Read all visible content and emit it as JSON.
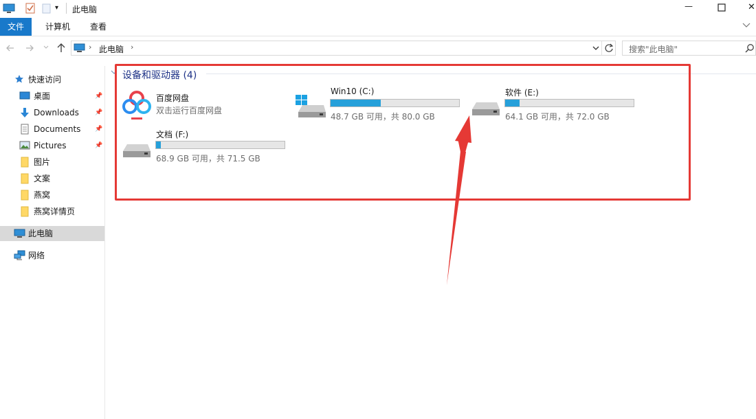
{
  "window": {
    "title": "此电脑",
    "minimize": "—",
    "maximize": "☐",
    "close": "✕"
  },
  "ribbon": {
    "tabs": [
      "文件",
      "计算机",
      "查看"
    ]
  },
  "address": {
    "location": "此电脑",
    "search_placeholder": "搜索\"此电脑\""
  },
  "sidebar": {
    "quick_access": "快速访问",
    "items": [
      {
        "label": "桌面",
        "icon": "desktop-icon",
        "pinned": true
      },
      {
        "label": "Downloads",
        "icon": "download-icon",
        "pinned": true
      },
      {
        "label": "Documents",
        "icon": "documents-icon",
        "pinned": true
      },
      {
        "label": "Pictures",
        "icon": "pictures-icon",
        "pinned": true
      },
      {
        "label": "图片",
        "icon": "folder-icon",
        "pinned": false
      },
      {
        "label": "文案",
        "icon": "folder-icon",
        "pinned": false
      },
      {
        "label": "燕窝",
        "icon": "folder-icon",
        "pinned": false
      },
      {
        "label": "燕窝详情页",
        "icon": "folder-icon",
        "pinned": false
      }
    ],
    "this_pc": "此电脑",
    "network": "网络"
  },
  "section": {
    "title": "设备和驱动器 (4)"
  },
  "devices": [
    {
      "name": "百度网盘",
      "subtitle": "双击运行百度网盘",
      "icon": "baidu-netdisk-icon"
    },
    {
      "name": "Win10 (C:)",
      "subtitle": "48.7 GB 可用，共 80.0 GB",
      "used_fraction": 0.39,
      "icon": "windows-drive-icon"
    },
    {
      "name": "软件 (E:)",
      "subtitle": "64.1 GB 可用，共 72.0 GB",
      "used_fraction": 0.11,
      "icon": "hard-drive-icon"
    },
    {
      "name": "文档 (F:)",
      "subtitle": "68.9 GB 可用，共 71.5 GB",
      "used_fraction": 0.04,
      "icon": "hard-drive-icon"
    }
  ],
  "colors": {
    "accent": "#1979ca",
    "bar_fill": "#26a0da",
    "annotation": "#e53935"
  }
}
